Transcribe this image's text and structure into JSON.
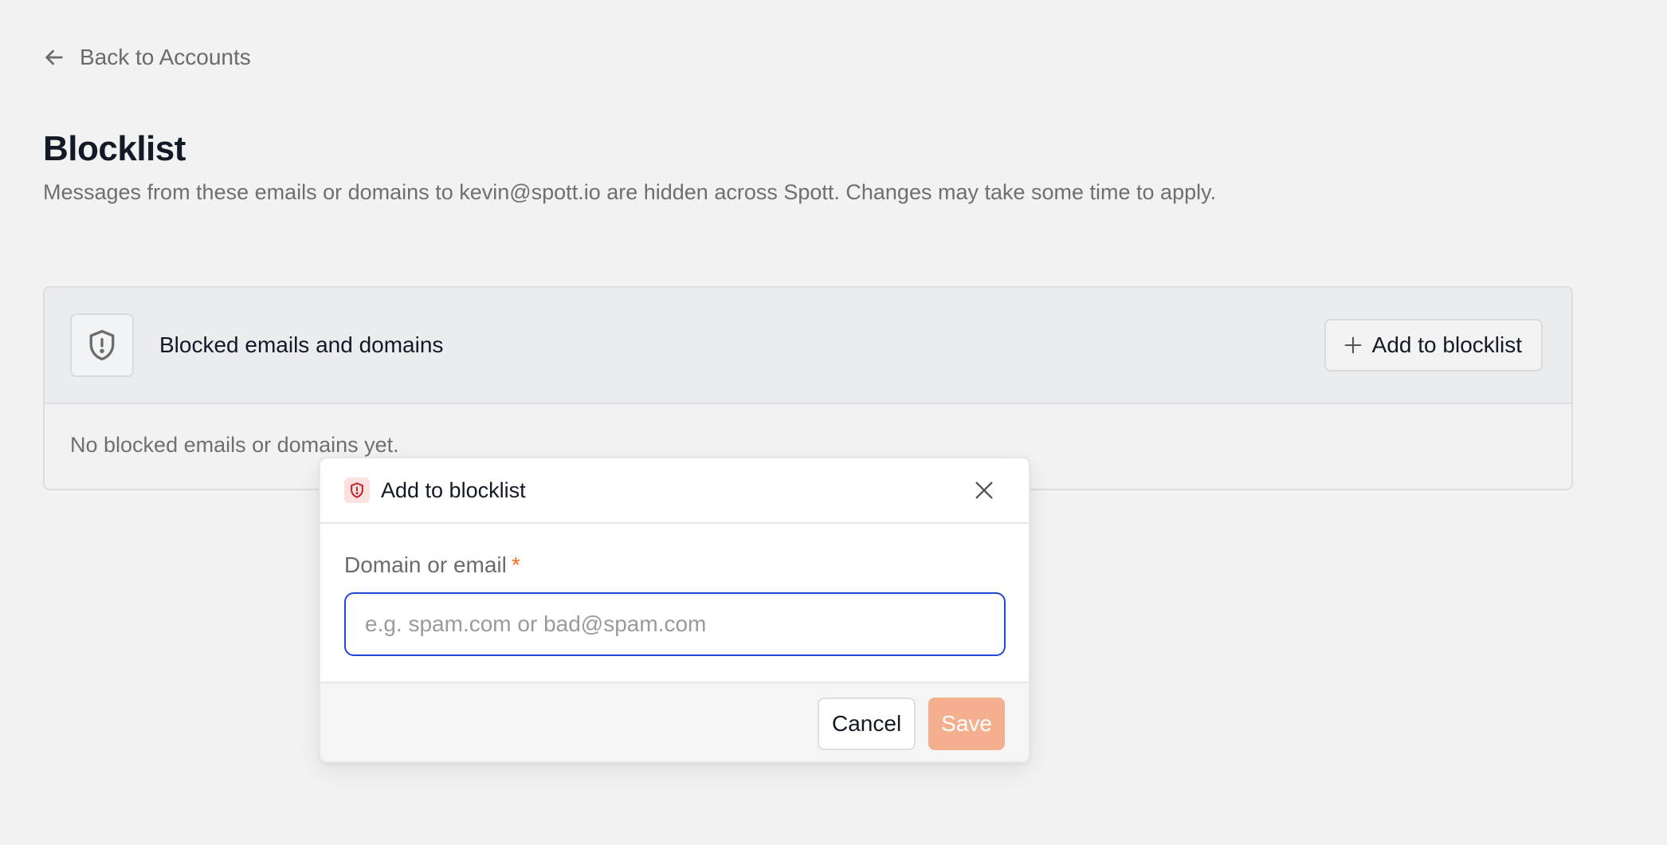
{
  "nav": {
    "back_label": "Back to Accounts",
    "back_icon": "arrow-left-icon"
  },
  "page": {
    "title": "Blocklist",
    "subtitle": "Messages from these emails or domains to kevin@spott.io are hidden across Spott. Changes may take some time to apply."
  },
  "card": {
    "icon": "shield-alert-icon",
    "title": "Blocked emails and domains",
    "add_button_label": "Add to blocklist",
    "add_button_icon": "plus-icon",
    "empty_text": "No blocked emails or domains yet."
  },
  "modal": {
    "icon": "shield-alert-icon",
    "title": "Add to blocklist",
    "close_icon": "close-icon",
    "field_label": "Domain or email",
    "required_marker": "*",
    "input_value": "",
    "input_placeholder": "e.g. spam.com or bad@spam.com",
    "cancel_label": "Cancel",
    "save_label": "Save"
  },
  "colors": {
    "background": "#f2f2f2",
    "accent_orange": "#f26b1d",
    "save_disabled": "#f4b08e",
    "focus_blue": "#2146d3",
    "danger_icon_bg": "#fde0e0",
    "danger_icon": "#c0242b"
  }
}
